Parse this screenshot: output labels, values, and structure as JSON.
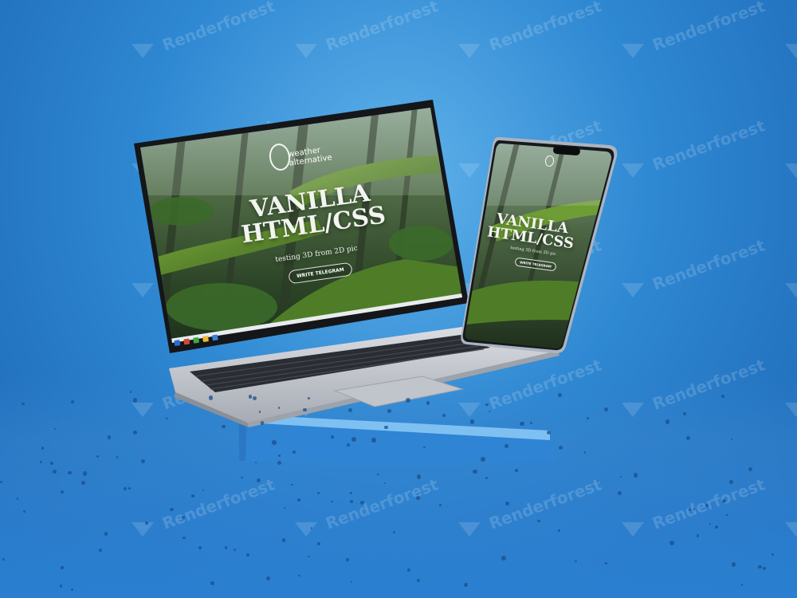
{
  "site": {
    "logo_line1": "weather",
    "logo_line2": "alternative",
    "headline_line1": "VANILLA",
    "headline_line2": "HTML/CSS",
    "tagline": "testing 3D from 2D pic",
    "laptop_button": "WRITE TELEGRAM",
    "phone_button": "WRITE TELEGRAM"
  },
  "watermark": {
    "text": "Renderforest"
  },
  "colors": {
    "background": "#2f88d2",
    "pedestal": "#3a8fdc",
    "laptop_body": "#c9ccd2",
    "forest_dark": "#1f3a1c",
    "moss": "#5b8a2a"
  },
  "icons": {
    "logo": "weather-logo-icon",
    "brand": "renderforest-logo-icon"
  }
}
